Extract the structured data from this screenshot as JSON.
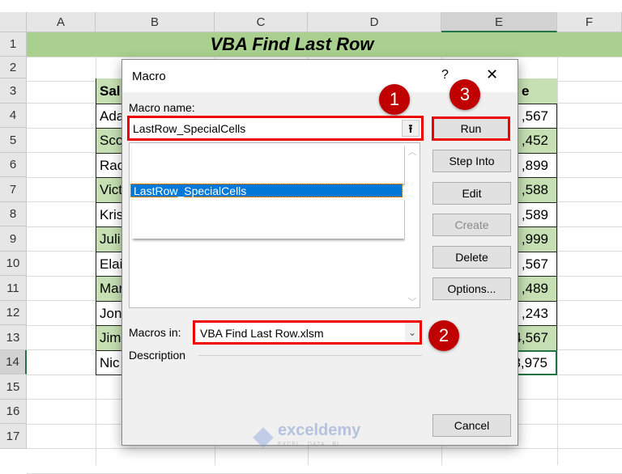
{
  "columns": [
    "A",
    "B",
    "C",
    "D",
    "E",
    "F"
  ],
  "rows": [
    "1",
    "2",
    "3",
    "4",
    "5",
    "6",
    "7",
    "8",
    "9",
    "10",
    "11",
    "12",
    "13",
    "14",
    "15",
    "16",
    "17"
  ],
  "sheet": {
    "title": "VBA Find Last Row",
    "header_b": "Sal",
    "header_e": "e",
    "names": [
      "Ada",
      "Sco",
      "Rac",
      "Vict",
      "Kris",
      "Juli",
      "Elai",
      "Mar",
      "Jon",
      "Jim",
      "Nic"
    ],
    "values": [
      ",567",
      ",452",
      ",899",
      ",588",
      ",589",
      ",999",
      ",567",
      ",489",
      ",243",
      "4,567",
      "3,975"
    ]
  },
  "dialog": {
    "title": "Macro",
    "help": "?",
    "close": "✕",
    "macro_name_label": "Macro name:",
    "macro_name_value": "LastRow_SpecialCells",
    "list_items": [
      "LastRow_SpecialCells"
    ],
    "macros_in_label": "Macros in:",
    "macros_in_value": "VBA Find Last Row.xlsm",
    "description_label": "Description",
    "buttons": {
      "run": "Run",
      "step_into": "Step Into",
      "edit": "Edit",
      "create": "Create",
      "delete": "Delete",
      "options": "Options...",
      "cancel": "Cancel"
    }
  },
  "badges": [
    "1",
    "2",
    "3"
  ],
  "watermark": {
    "name": "exceldemy",
    "tagline": "EXCEL · DATA · BI"
  },
  "colors": {
    "accent_red": "#e00000",
    "badge_red": "#c00000",
    "table_green": "#c6e0b4",
    "title_green": "#a9d08e",
    "selection_blue": "#0078d7"
  }
}
